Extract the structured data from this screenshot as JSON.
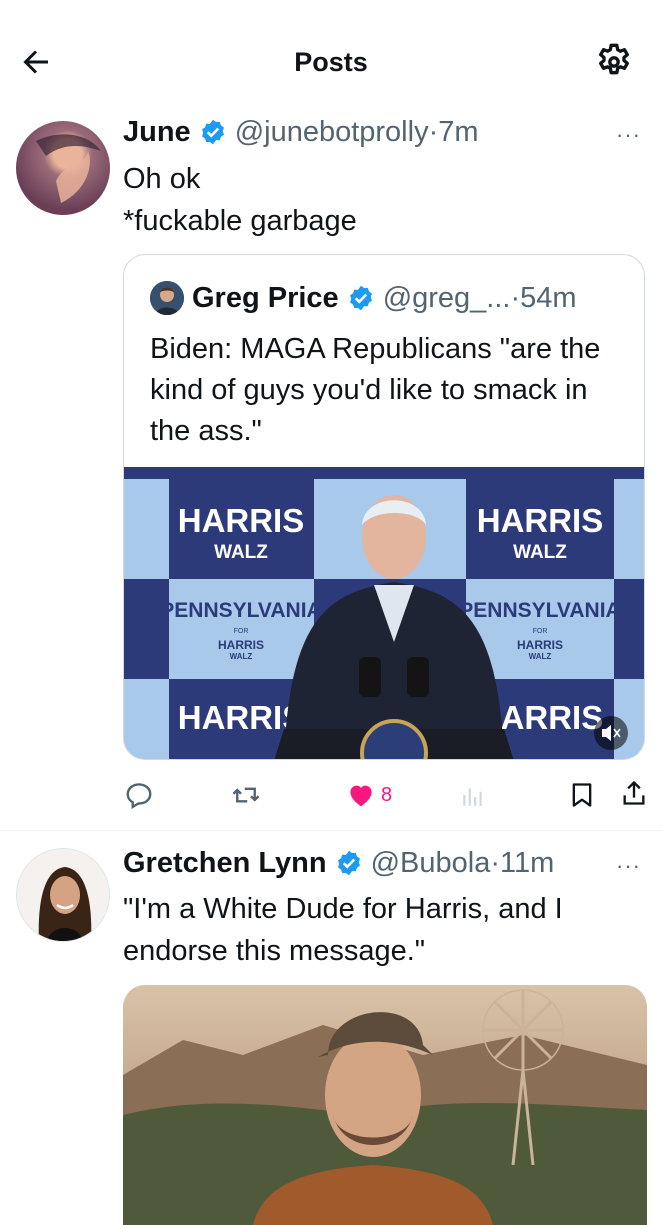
{
  "header": {
    "title": "Posts",
    "back_icon": "arrow-left-icon",
    "settings_icon": "gear-icon"
  },
  "posts": [
    {
      "name": "June",
      "verified": true,
      "handle": "@junebotprolly",
      "sep": "·",
      "time": "7m",
      "more": "···",
      "lines": [
        "Oh ok",
        "*fuckable garbage"
      ],
      "quote": {
        "name": "Greg Price",
        "verified": true,
        "handle": "@greg_...",
        "sep": "·",
        "time": "54m",
        "text": "Biden: MAGA Republicans \"are the kind of guys you'd like to smack in the ass.\"",
        "media": {
          "signs": [
            "HARRIS",
            "WALZ",
            "PENNSYLVANIA",
            "FOR",
            "HARRIS",
            "WALZ"
          ],
          "mute_icon": "volume-muted-icon"
        }
      },
      "actions": {
        "reply_icon": "reply-icon",
        "repost_icon": "repost-icon",
        "like_icon": "heart-filled-icon",
        "like_count": "8",
        "views_icon": "bar-chart-icon",
        "bookmark_icon": "bookmark-icon",
        "share_icon": "share-icon",
        "like_color": "#f91880"
      }
    },
    {
      "name": "Gretchen Lynn",
      "verified": true,
      "handle": "@Bubola",
      "sep": "·",
      "time": "11m",
      "more": "···",
      "lines": [
        "\"I'm a White Dude for Harris, and I",
        "endorse this message.\""
      ]
    }
  ],
  "colors": {
    "verified": "#1d9bf0",
    "secondary_text": "#536471",
    "border": "#cfd9de"
  }
}
